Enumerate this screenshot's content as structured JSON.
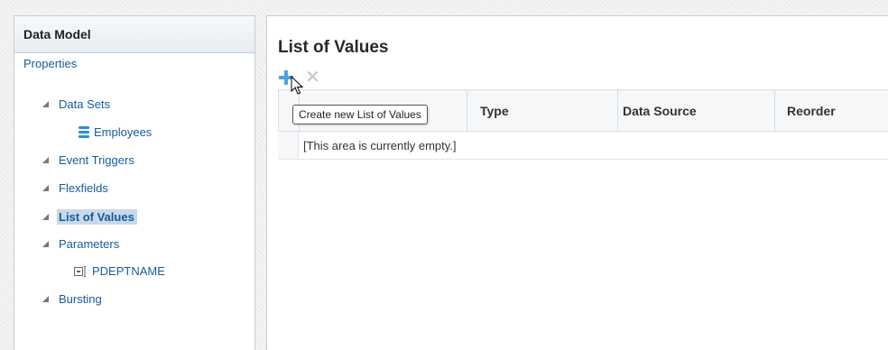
{
  "left_panel": {
    "title": "Data Model",
    "root": "Properties",
    "items": [
      {
        "label": "Data Sets",
        "children": [
          {
            "label": "Employees",
            "icon": "database-icon"
          }
        ]
      },
      {
        "label": "Event Triggers"
      },
      {
        "label": "Flexfields"
      },
      {
        "label": "List of Values",
        "selected": true
      },
      {
        "label": "Parameters",
        "children": [
          {
            "label": "PDEPTNAME",
            "icon": "parameter-icon"
          }
        ]
      },
      {
        "label": "Bursting"
      }
    ]
  },
  "main": {
    "title": "List of Values",
    "toolbar": {
      "add_icon": "plus-icon",
      "delete_icon": "close-icon",
      "tooltip": "Create new List of Values"
    },
    "table": {
      "columns": [
        "Type",
        "Data Source",
        "Reorder"
      ],
      "empty_message": "[This area is currently empty.]"
    }
  },
  "colors": {
    "link": "#145c9e",
    "selected_bg": "#c9d9e8",
    "add_icon": "#4aa3df",
    "delete_icon": "#c2c2c2"
  }
}
